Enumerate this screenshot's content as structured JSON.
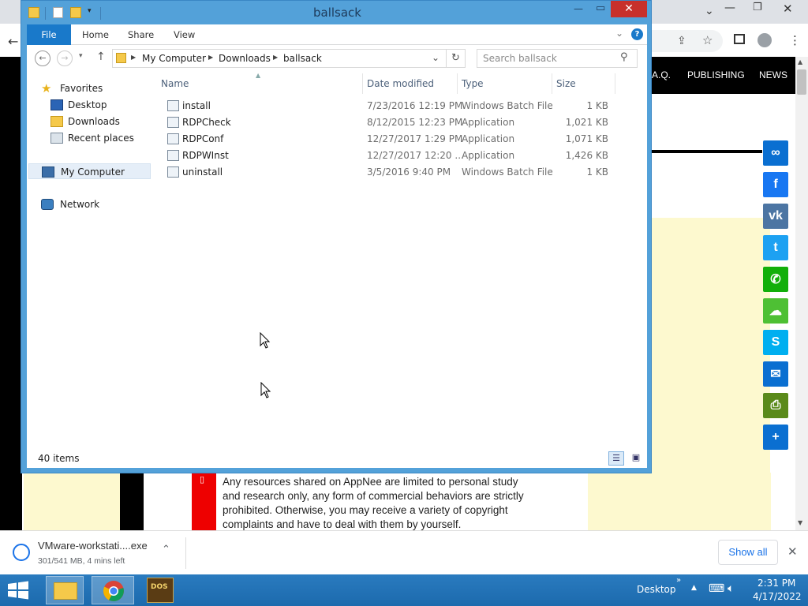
{
  "explorer": {
    "title": "ballsack",
    "ribbon_tabs": [
      "File",
      "Home",
      "Share",
      "View"
    ],
    "breadcrumb": [
      "My Computer",
      "Downloads",
      "ballsack"
    ],
    "search_placeholder": "Search ballsack",
    "nav": {
      "favorites": "Favorites",
      "desktop": "Desktop",
      "downloads": "Downloads",
      "recent": "Recent places",
      "computer": "My Computer",
      "network": "Network"
    },
    "columns": {
      "name": "Name",
      "date": "Date modified",
      "type": "Type",
      "size": "Size"
    },
    "files": [
      {
        "name": "install",
        "date": "7/23/2016 12:19 PM",
        "type": "Windows Batch File",
        "size": "1 KB"
      },
      {
        "name": "RDPCheck",
        "date": "8/12/2015 12:23 PM",
        "type": "Application",
        "size": "1,021 KB"
      },
      {
        "name": "RDPConf",
        "date": "12/27/2017 1:29 PM",
        "type": "Application",
        "size": "1,071 KB"
      },
      {
        "name": "RDPWInst",
        "date": "12/27/2017 12:20 ...",
        "type": "Application",
        "size": "1,426 KB"
      },
      {
        "name": "uninstall",
        "date": "3/5/2016 9:40 PM",
        "type": "Windows Batch File",
        "size": "1 KB"
      }
    ],
    "status": "40 items"
  },
  "site": {
    "nav_items": [
      "A.Q.",
      "PUBLISHING",
      "NEWS"
    ],
    "notice": "Any resources shared on AppNee are limited to personal study and research only, any form of commercial behaviors are strictly prohibited. Otherwise, you may receive a variety of copyright complaints and have to deal with them by yourself.",
    "share_icons": [
      {
        "name": "copy-link-icon",
        "color": "#0a6fd1",
        "glyph": "∞"
      },
      {
        "name": "facebook-icon",
        "color": "#1877f2",
        "glyph": "f"
      },
      {
        "name": "vk-icon",
        "color": "#4c75a3",
        "glyph": "vk"
      },
      {
        "name": "twitter-icon",
        "color": "#1da1f2",
        "glyph": "t"
      },
      {
        "name": "whatsapp-icon",
        "color": "#12af0a",
        "glyph": "✆"
      },
      {
        "name": "wechat-icon",
        "color": "#4ec034",
        "glyph": "☁"
      },
      {
        "name": "skype-icon",
        "color": "#00aff0",
        "glyph": "S"
      },
      {
        "name": "email-icon",
        "color": "#0a6fd1",
        "glyph": "✉"
      },
      {
        "name": "print-icon",
        "color": "#5a8a1a",
        "glyph": "⎙"
      },
      {
        "name": "share-icon",
        "color": "#0a6fd1",
        "glyph": "+"
      }
    ]
  },
  "download": {
    "file": "VMware-workstati....exe",
    "progress": "301/541 MB, 4 mins left",
    "show_all": "Show all"
  },
  "taskbar": {
    "desktop_label": "Desktop",
    "time": "2:31 PM",
    "date": "4/17/2022"
  }
}
